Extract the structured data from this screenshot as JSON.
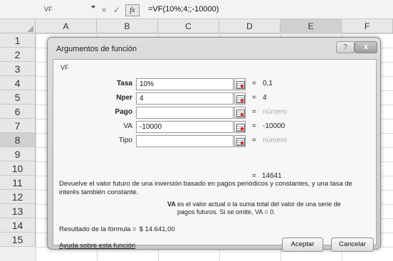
{
  "formula_bar": {
    "name_box": "VF",
    "cancel_glyph": "×",
    "enter_glyph": "✓",
    "fx_label": "fx",
    "formula": "=VF(10%;4;;-10000)"
  },
  "columns": [
    "A",
    "B",
    "C",
    "D",
    "E",
    "F"
  ],
  "rows": [
    "1",
    "2",
    "3",
    "4",
    "5",
    "6",
    "7",
    "8",
    "9",
    "10",
    "11",
    "12",
    "13",
    "14",
    "15"
  ],
  "dialog": {
    "title": "Argumentos de función",
    "help_glyph": "?",
    "close_glyph": "x",
    "function_name": "VF",
    "args": [
      {
        "label": "Tasa",
        "value": "10%",
        "eq": "=",
        "result": "0,1",
        "bold": true,
        "muted": false
      },
      {
        "label": "Nper",
        "value": "4",
        "eq": "=",
        "result": "4",
        "bold": true,
        "muted": false
      },
      {
        "label": "Pago",
        "value": "",
        "eq": "=",
        "result": "número",
        "bold": true,
        "muted": true
      },
      {
        "label": "VA",
        "value": "-10000",
        "eq": "=",
        "result": "-10000",
        "bold": false,
        "muted": false
      },
      {
        "label": "Tipo",
        "value": "",
        "eq": "=",
        "result": "número",
        "bold": false,
        "muted": true
      }
    ],
    "total_eq": "=",
    "total_result": "14641",
    "description": "Devuelve el valor futuro de una inversión basado en pagos periódicos y constantes, y una tasa de interés también constante.",
    "param_name": "VA",
    "param_description": "es el valor actual o la suma total del valor de una serie de pagos futuros. Si se omite, VA = 0.",
    "result_label": "Resultado de la fórmula =",
    "result_value": "$ 14.641,00",
    "help_link": "Ayuda sobre esta función",
    "ok_label": "Aceptar",
    "cancel_label": "Cancelar"
  }
}
